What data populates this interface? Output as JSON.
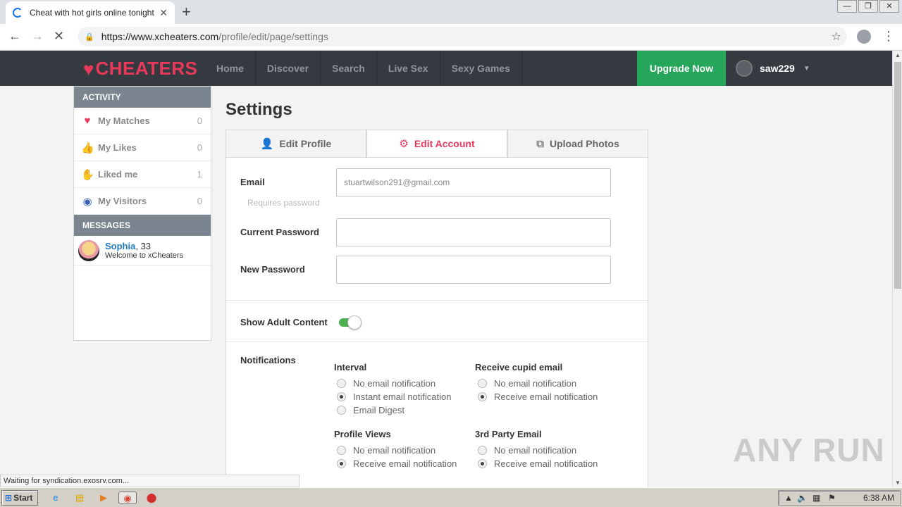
{
  "browser": {
    "tab_title": "Cheat with hot girls online tonight fo",
    "tab_close": "✕",
    "new_tab": "+",
    "url_host": "https://www.xcheaters.com",
    "url_path": "/profile/edit/page/settings",
    "status_text": "Waiting for syndication.exosrv.com..."
  },
  "site": {
    "brand": "CHEATERS",
    "brand_color": "#e8395a",
    "nav": [
      "Home",
      "Discover",
      "Search",
      "Live Sex",
      "Sexy Games"
    ],
    "upgrade_label": "Upgrade Now",
    "username": "saw229"
  },
  "sidebar": {
    "activity_header": "ACTIVITY",
    "items": [
      {
        "label": "My Matches",
        "count": "0",
        "icon": "heart-icon"
      },
      {
        "label": "My Likes",
        "count": "0",
        "icon": "thumbs-up-icon"
      },
      {
        "label": "Liked me",
        "count": "1",
        "icon": "hand-icon"
      },
      {
        "label": "My Visitors",
        "count": "0",
        "icon": "eye-icon"
      }
    ],
    "messages_header": "MESSAGES",
    "message": {
      "name": "Sophia",
      "age": ", 33",
      "preview": "Welcome to xCheaters"
    }
  },
  "main": {
    "title": "Settings",
    "tabs": [
      {
        "label": "Edit Profile",
        "icon": "user-icon"
      },
      {
        "label": "Edit Account",
        "icon": "gear-icon"
      },
      {
        "label": "Upload Photos",
        "icon": "photos-icon"
      }
    ],
    "email_label": "Email",
    "email_value": "stuartwilson291@gmail.com",
    "requires_password": "Requires password",
    "current_password_label": "Current Password",
    "new_password_label": "New Password",
    "adult_content_label": "Show Adult Content",
    "notifications_label": "Notifications",
    "groups": [
      {
        "title": "Interval",
        "options": [
          "No email notification",
          "Instant email notification",
          "Email Digest"
        ],
        "selected": 1
      },
      {
        "title": "Receive cupid email",
        "options": [
          "No email notification",
          "Receive email notification"
        ],
        "selected": 1
      },
      {
        "title": "Profile Views",
        "options": [
          "No email notification",
          "Receive email notification"
        ],
        "selected": 1
      },
      {
        "title": "3rd Party Email",
        "options": [
          "No email notification",
          "Receive email notification"
        ],
        "selected": 1
      }
    ]
  },
  "taskbar": {
    "start_label": "Start",
    "clock": "6:38 AM"
  },
  "watermark": "ANY RUN"
}
